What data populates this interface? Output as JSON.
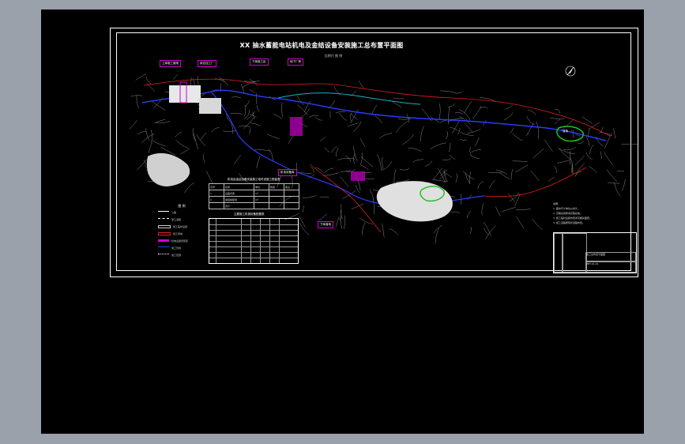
{
  "drawing": {
    "title": "XX 抽水蓄能电站机电及金结设备安装施工总布置平面图",
    "subtitle": "比例尺  图  例",
    "callouts": [
      "上库施工营地",
      "综合加工厂",
      "下库施工区",
      "地下厂房",
      "机电设备库",
      "下库营地"
    ],
    "green_area_label": "渣场",
    "table1": {
      "title": "机电及金结设备安装施工临时设施工程量表",
      "header": [
        "序号",
        "名称",
        "单位",
        "数量",
        "备注"
      ],
      "rows": [
        [
          "1",
          "设备仓库",
          "m²",
          "",
          ""
        ],
        [
          "2",
          "金结拼装场",
          "m²",
          "",
          ""
        ],
        [
          "",
          "合计",
          "",
          "",
          ""
        ]
      ]
    },
    "table2": {
      "title": "主要施工机械设备配置表"
    },
    "legend": {
      "title": "图 例",
      "items": [
        "公路",
        "施工道路",
        "施工临时设施",
        "施工场地",
        "机电设备安装区",
        "施工管线",
        "施工范围"
      ]
    },
    "notes": [
      "说明：",
      "1. 图中尺寸单位以米计。",
      "2. 高程采用黄海高程系统。",
      "3. 施工临时设施布置详见相关图纸。",
      "4. 施工道路按现状道路布置。"
    ],
    "title_block": {
      "drawing_name": "施工总布置平面图",
      "drawing_no": "ZBT-01-01"
    }
  },
  "colors": {
    "sheet_bg": "#000000",
    "frame": "#ffffff",
    "contour": "#9a9a9a",
    "river": "#2030ff",
    "road": "#ff2020",
    "facility": "#d000d0",
    "green_zone": "#20c020",
    "water": "#1ab0c0"
  }
}
